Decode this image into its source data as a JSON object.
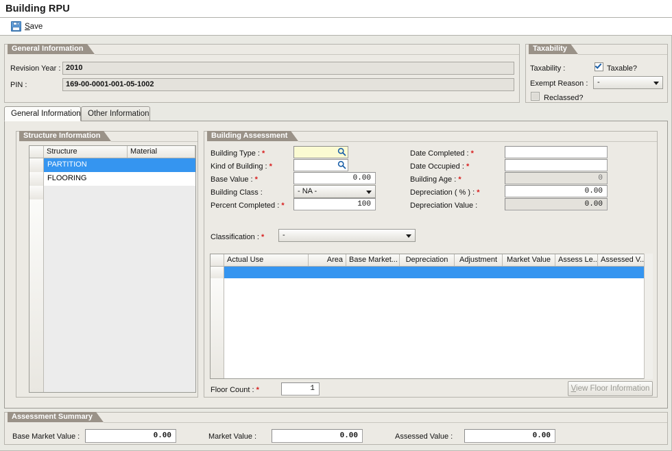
{
  "window": {
    "title": "Building RPU"
  },
  "toolbar": {
    "save_label": "Save",
    "save_mnemonic": "S",
    "save_rest": "ave",
    "save_icon": "floppy-disk-icon"
  },
  "general_information": {
    "caption": "General Information",
    "revision_year_label": "Revision Year :",
    "revision_year_value": "2010",
    "pin_label": "PIN :",
    "pin_value": "169-00-0001-001-05-1002"
  },
  "taxability": {
    "caption": "Taxability",
    "taxability_label": "Taxability :",
    "taxable_label": "Taxable?",
    "taxable_checked": true,
    "exempt_reason_label": "Exempt Reason :",
    "exempt_reason_value": "-",
    "reclassed_label": "Reclassed?",
    "reclassed_checked": false
  },
  "tabs": [
    {
      "label": "General Information",
      "active": true
    },
    {
      "label": "Other Information",
      "active": false
    }
  ],
  "structure_information": {
    "caption": "Structure Information",
    "columns": [
      "Structure",
      "Material"
    ],
    "rows": [
      {
        "structure": "PARTITION",
        "material": "",
        "selected": true
      },
      {
        "structure": "FLOORING",
        "material": "",
        "selected": false
      }
    ]
  },
  "building_assessment": {
    "caption": "Building Assessment",
    "fields_left": [
      {
        "label": "Building Type :",
        "required": true,
        "value": "",
        "type": "lookup",
        "focused": true
      },
      {
        "label": "Kind of Building :",
        "required": true,
        "value": "",
        "type": "lookup",
        "focused": false
      },
      {
        "label": "Base Value :",
        "required": true,
        "value": "0.00",
        "type": "number"
      },
      {
        "label": "Building Class :",
        "required": false,
        "value": "- NA -",
        "type": "combo"
      },
      {
        "label": "Percent Completed :",
        "required": true,
        "value": "100",
        "type": "number"
      }
    ],
    "fields_right": [
      {
        "label": "Date Completed :",
        "required": true,
        "value": "",
        "type": "text",
        "readonly": false
      },
      {
        "label": "Date Occupied :",
        "required": true,
        "value": "",
        "type": "text",
        "readonly": false
      },
      {
        "label": "Building Age :",
        "required": true,
        "value": "0",
        "type": "number",
        "readonly": true
      },
      {
        "label": "Depreciation ( % ) :",
        "required": true,
        "value": "0.00",
        "type": "number",
        "readonly": false
      },
      {
        "label": "Depreciation Value :",
        "required": false,
        "value": "0.00",
        "type": "number",
        "readonly": true
      }
    ],
    "classification_label": "Classification :",
    "classification_required": true,
    "classification_value": "-",
    "grid": {
      "columns": [
        "Actual Use",
        "Area",
        "Base Market...",
        "Depreciation",
        "Adjustment",
        "Market Value",
        "Assess Le...",
        "Assessed V..."
      ],
      "rows": [
        {
          "actual_use": "",
          "area": "",
          "base_market": "",
          "depreciation": "",
          "adjustment": "",
          "market_value": "",
          "assess_level": "",
          "assessed_value": "",
          "selected": true
        }
      ]
    },
    "floor_count_label": "Floor Count :",
    "floor_count_required": true,
    "floor_count_value": "1",
    "view_floor_button": "View Floor Information",
    "view_floor_mnemonic": "V",
    "view_floor_rest": "iew Floor Information",
    "view_floor_disabled": true
  },
  "assessment_summary": {
    "caption": "Assessment Summary",
    "items": [
      {
        "label": "Base Market Value :",
        "value": "0.00"
      },
      {
        "label": "Market Value  :",
        "value": "0.00"
      },
      {
        "label": "Assessed Value :",
        "value": "0.00"
      }
    ]
  },
  "colors": {
    "panel_caption": "#9a9288",
    "selection_blue": "#3595f0",
    "required_red": "#d81e1e",
    "focus_yellow": "#fbfbd2",
    "window_bg": "#e9e9e3",
    "lookup_icon": "#1a5fa8"
  }
}
